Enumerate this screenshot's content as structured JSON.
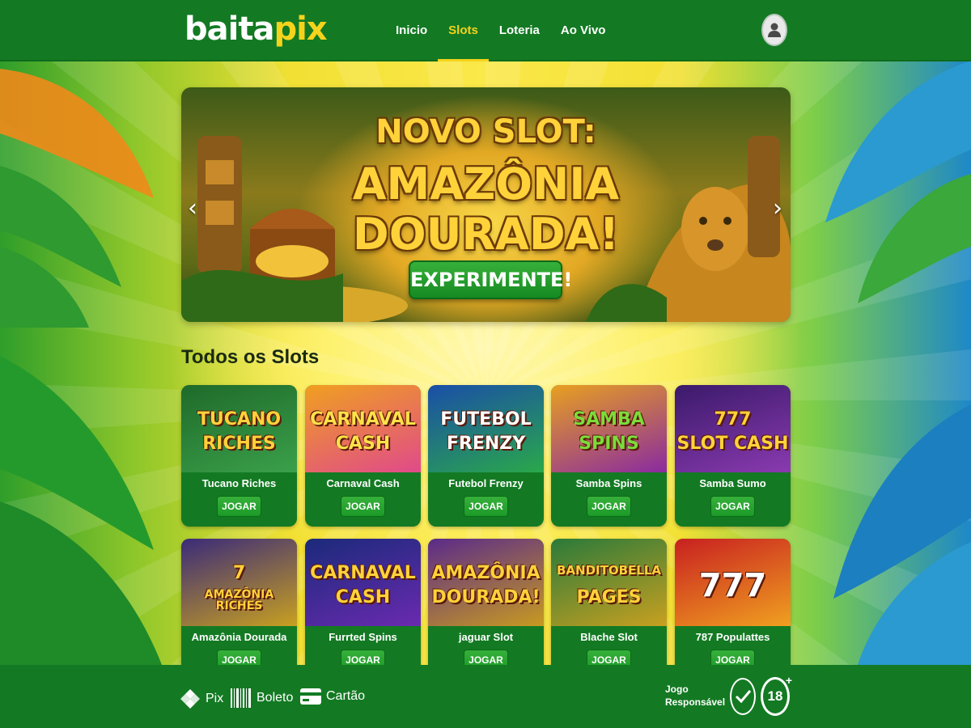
{
  "header": {
    "logo_part1": "baita",
    "logo_part2": "pix",
    "nav": [
      {
        "label": "Inicio",
        "active": false
      },
      {
        "label": "Slots",
        "active": true
      },
      {
        "label": "Loteria",
        "active": false
      },
      {
        "label": "Ao Vivo",
        "active": false
      }
    ],
    "profile_icon": "user-icon"
  },
  "banner": {
    "line1": "NOVO SLOT:",
    "line2": "AMAZÔNIA",
    "line3": "DOURADA!",
    "cta": "EXPERIMENTE!",
    "prev_icon": "chevron-left-icon",
    "next_icon": "chevron-right-icon"
  },
  "section_title": "Todos os Slots",
  "games": [
    {
      "art": [
        "TUCANO",
        "RICHES"
      ],
      "name": "Tucano Riches",
      "button": "JOGAR",
      "colors": [
        "#1f6a2a",
        "#3aa04a"
      ],
      "text_color": "#ffd23a"
    },
    {
      "art": [
        "CARNAVAL",
        "CASH"
      ],
      "name": "Carnaval Cash",
      "button": "JOGAR",
      "colors": [
        "#f0a020",
        "#e04a8a"
      ],
      "text_color": "#ffe14a"
    },
    {
      "art": [
        "FUTEBOL",
        "FRENZY"
      ],
      "name": "Futebol Frenzy",
      "button": "JOGAR",
      "colors": [
        "#1a4ea8",
        "#2aa84a"
      ],
      "text_color": "#ffffff"
    },
    {
      "art": [
        "SAMBA",
        "SPINS"
      ],
      "name": "Samba Spins",
      "button": "JOGAR",
      "colors": [
        "#e8a020",
        "#8a2aa0"
      ],
      "text_color": "#7bdc3a"
    },
    {
      "art": [
        "777",
        "SLOT CASH"
      ],
      "name": "Samba Sumo",
      "button": "JOGAR",
      "colors": [
        "#3a1a6a",
        "#8a3ab0"
      ],
      "text_color": "#ffd23a"
    },
    {
      "art": [
        "7",
        "AMAZÔNIA RICHES"
      ],
      "name": "Amazônia Dourada",
      "button": "JOGAR",
      "colors": [
        "#3a2a7a",
        "#c8a020"
      ],
      "text_color": "#ffd23a"
    },
    {
      "art": [
        "CARNAVAL",
        "CASH"
      ],
      "name": "Furrted Spins",
      "button": "JOGAR",
      "colors": [
        "#1a2a7a",
        "#6a2ab0"
      ],
      "text_color": "#ffd23a"
    },
    {
      "art": [
        "AMAZÔNIA",
        "DOURADA!"
      ],
      "name": "jaguar Slot",
      "button": "JOGAR",
      "colors": [
        "#5a2a8a",
        "#c89a20"
      ],
      "text_color": "#ffd23a"
    },
    {
      "art": [
        "BANDITOBELLA",
        "PAGES"
      ],
      "name": "Blache Slot",
      "button": "JOGAR",
      "colors": [
        "#2a7a3a",
        "#c8a020"
      ],
      "text_color": "#ffd23a"
    },
    {
      "art": [
        "777",
        ""
      ],
      "name": "787 Populattes",
      "button": "JOGAR",
      "colors": [
        "#c82020",
        "#f0a020"
      ],
      "text_color": "#ffffff"
    }
  ],
  "footer": {
    "payments": [
      {
        "label": "Pix",
        "icon": "pix-icon"
      },
      {
        "label": "Boleto",
        "icon": "barcode-icon"
      },
      {
        "label": "Cartão",
        "icon": "card-icon"
      }
    ],
    "responsible_line1": "Jogo",
    "responsible_line2": "Responsável",
    "age": "18",
    "age_plus": "+"
  }
}
